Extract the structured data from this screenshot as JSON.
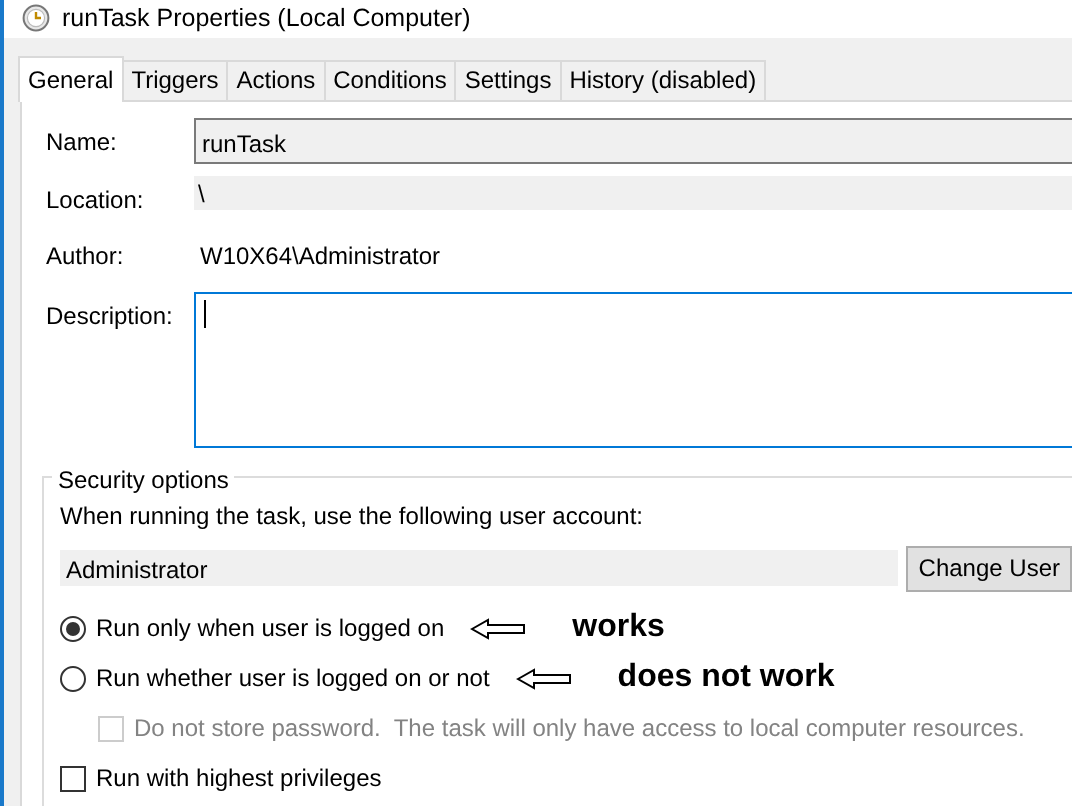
{
  "window": {
    "title": "runTask Properties (Local Computer)"
  },
  "tabs": [
    {
      "label": "General",
      "selected": true
    },
    {
      "label": "Triggers",
      "selected": false
    },
    {
      "label": "Actions",
      "selected": false
    },
    {
      "label": "Conditions",
      "selected": false
    },
    {
      "label": "Settings",
      "selected": false
    },
    {
      "label": "History (disabled)",
      "selected": false
    }
  ],
  "fields": [
    {
      "label": "Name:",
      "value": "runTask",
      "kind": "input"
    },
    {
      "label": "Location:",
      "value": "\\",
      "kind": "readonly"
    },
    {
      "label": "Author:",
      "value": "W10X64\\Administrator",
      "kind": "plain"
    },
    {
      "label": "Description:",
      "kind": "textarea"
    }
  ],
  "security": {
    "title": "Security options",
    "prompt": "When running the task, use the following user account:",
    "account": "Administrator",
    "change_button": "Change User",
    "options": [
      {
        "kind": "radio",
        "label": "Run only when user is logged on",
        "selected": true,
        "annotation": "works"
      },
      {
        "kind": "radio",
        "label": "Run whether user is logged on or not",
        "selected": false,
        "annotation": "does not work",
        "children": [
          {
            "kind": "checkbox",
            "label": "Do not store password.  The task will only have access to local computer resources.",
            "checked": false,
            "disabled": true
          }
        ]
      },
      {
        "kind": "checkbox",
        "label": "Run with highest privileges",
        "checked": false,
        "disabled": false
      }
    ]
  }
}
